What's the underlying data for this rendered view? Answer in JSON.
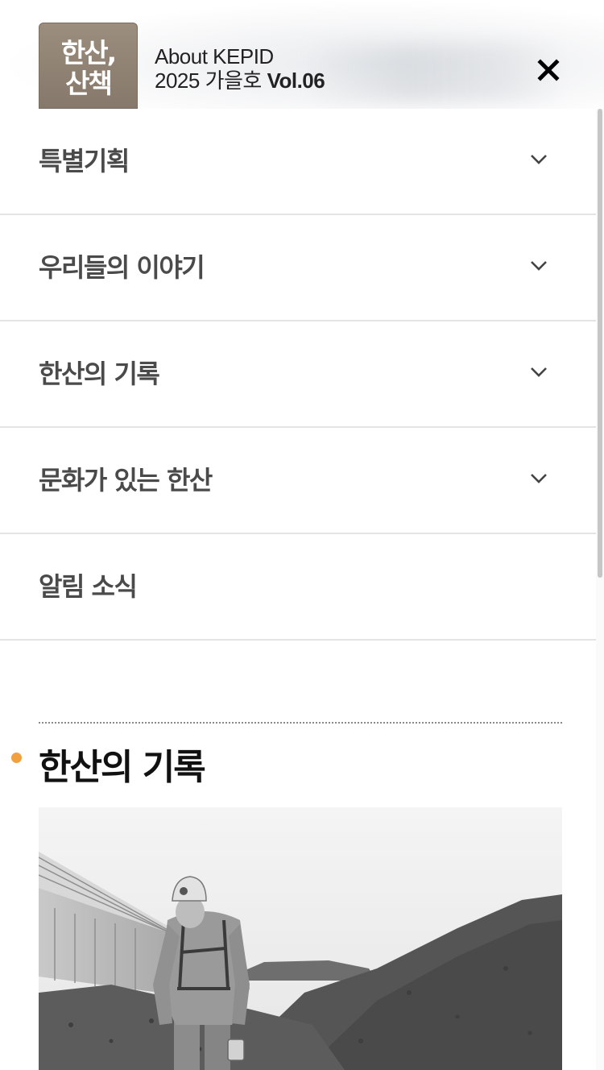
{
  "header": {
    "logo_line1": "한산,",
    "logo_line2": "산책",
    "about": "About KEPID",
    "issue": "2025 가을호",
    "volume": "Vol.06",
    "close_icon": "close-icon",
    "logo_color": "#8f8171"
  },
  "menu": {
    "items": [
      {
        "label": "특별기획",
        "icon": "chevron-down-icon"
      },
      {
        "label": "우리들의 이야기",
        "icon": "chevron-down-icon"
      },
      {
        "label": "한산의 기록",
        "icon": "chevron-down-icon"
      },
      {
        "label": "문화가 있는 한산",
        "icon": "chevron-down-icon"
      },
      {
        "label": "알림 소식"
      }
    ]
  },
  "section": {
    "title": "한산의 기록",
    "accent_color": "#f2a03d"
  }
}
